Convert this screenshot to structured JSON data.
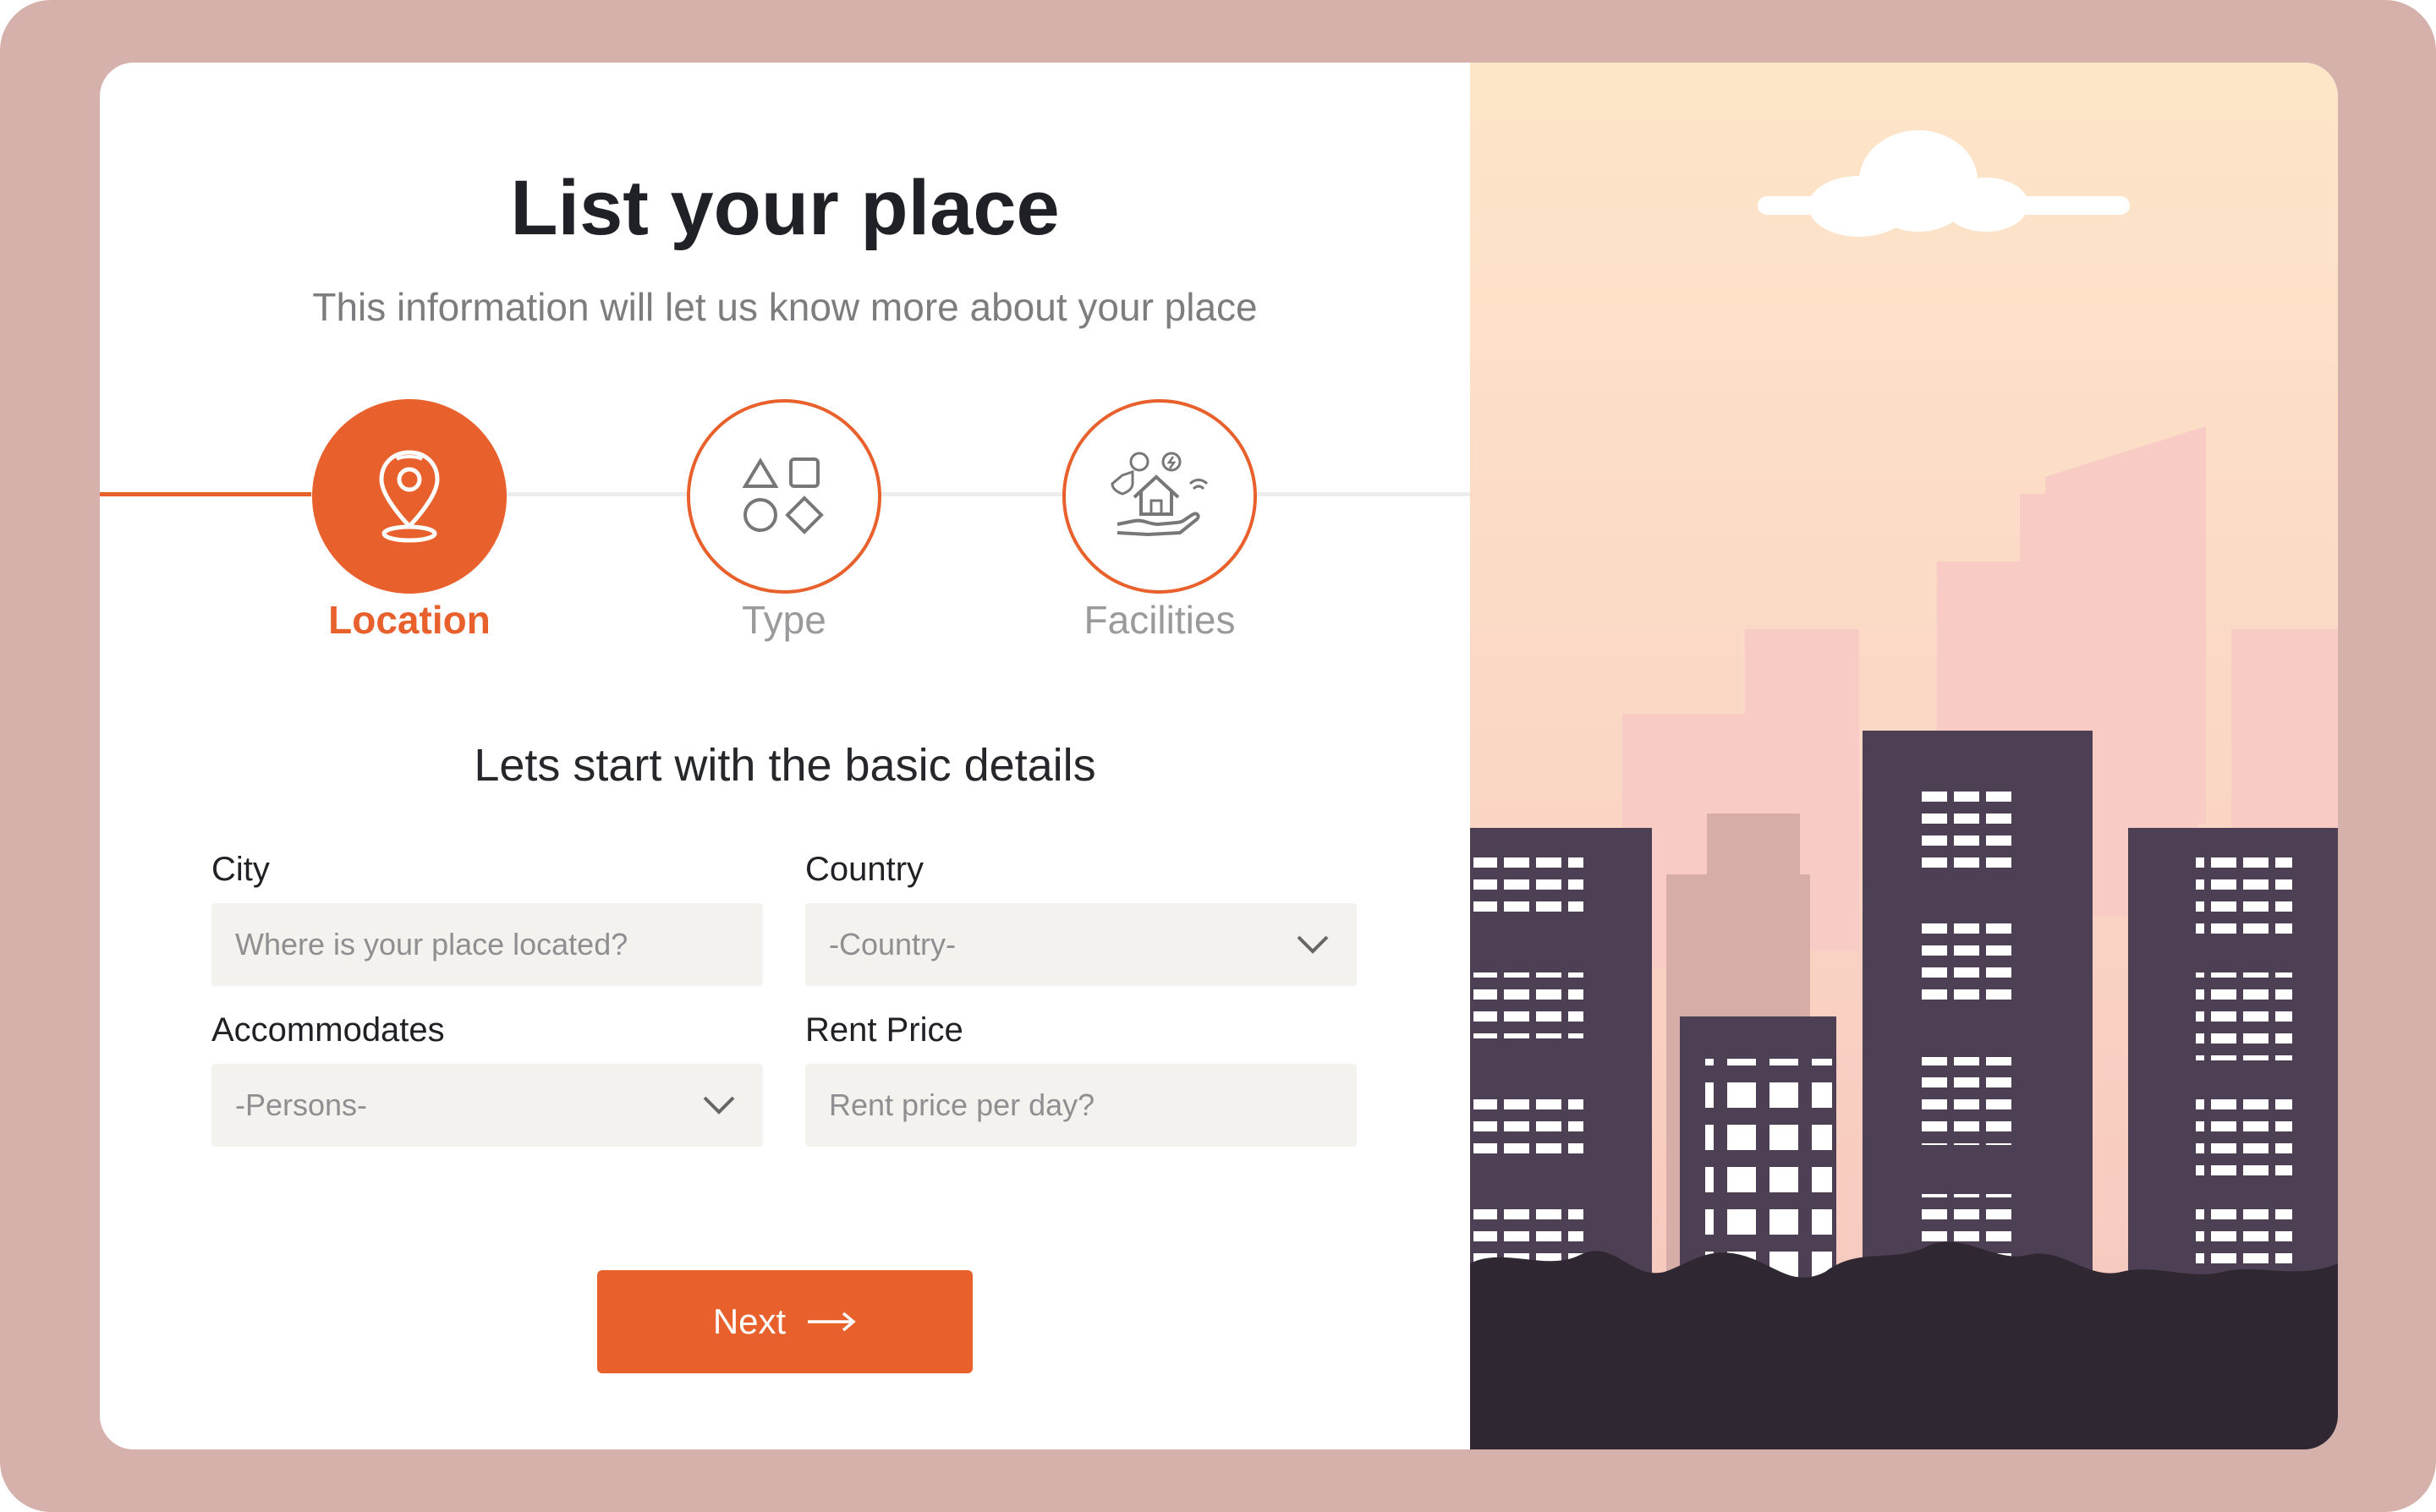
{
  "page": {
    "title": "List your place",
    "subtitle": "This information will let us know more about your place"
  },
  "steps": [
    {
      "label": "Location",
      "icon": "map-pin-icon",
      "state": "active"
    },
    {
      "label": "Type",
      "icon": "shapes-icon",
      "state": "inactive"
    },
    {
      "label": "Facilities",
      "icon": "house-amenities-icon",
      "state": "inactive"
    }
  ],
  "form": {
    "heading": "Lets start with the basic details",
    "city": {
      "label": "City",
      "placeholder": "Where is your place located?"
    },
    "country": {
      "label": "Country",
      "value": "-Country-"
    },
    "accommodates": {
      "label": "Accommodates",
      "value": "-Persons-"
    },
    "rent_price": {
      "label": "Rent Price",
      "placeholder": "Rent price per day?"
    }
  },
  "actions": {
    "next_label": "Next"
  },
  "colors": {
    "accent": "#e8602c",
    "frame": "#d6b1ab",
    "card": "#ffffff",
    "input_bg": "#f3f2ef",
    "building_dark": "#4d4054",
    "trees": "#2f2833"
  }
}
